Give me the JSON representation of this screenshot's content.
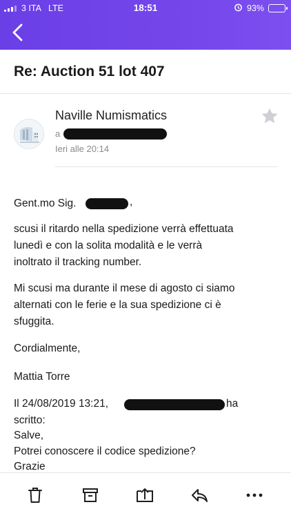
{
  "status_bar": {
    "carrier": "3 ITA",
    "network": "LTE",
    "time": "18:51",
    "battery": "93%",
    "battery_level": 0.93
  },
  "email": {
    "subject": "Re: Auction 51 lot 407",
    "sender": "Naville Numismatics",
    "recipient_prefix": "a",
    "timestamp": "Ieri alle 20:14",
    "body": {
      "greeting": "Gent.mo Sig.",
      "greeting_suffix": ",",
      "p1": [
        "scusi il ritardo nella spedizione verrà effettuata",
        "lunedì e con la solita modalità  e le verrà",
        "inoltrato il tracking number."
      ],
      "p2": [
        "Mi scusi ma durante il mese di agosto ci siamo",
        "alternati con le ferie e la sua spedizione ci è",
        "sfuggita."
      ],
      "closing": "Cordialmente,",
      "signature": "Mattia Torre",
      "quote_prefix": "Il 24/08/2019 13:21,",
      "quote_suffix": "ha",
      "quote_lines": [
        "scritto:",
        "Salve,",
        "Potrei conoscere il codice spedizione?",
        "Grazie"
      ]
    }
  },
  "colors": {
    "header_bg": "#7446ea",
    "text": "#1a1a1a",
    "muted": "#8a8a8e",
    "icon": "#1f1f1f"
  },
  "icons": {
    "back": "chevron-left-icon",
    "star": "star-icon",
    "delete": "trash-icon",
    "archive": "archive-icon",
    "move": "move-to-folder-icon",
    "reply": "reply-icon",
    "more": "more-icon"
  }
}
